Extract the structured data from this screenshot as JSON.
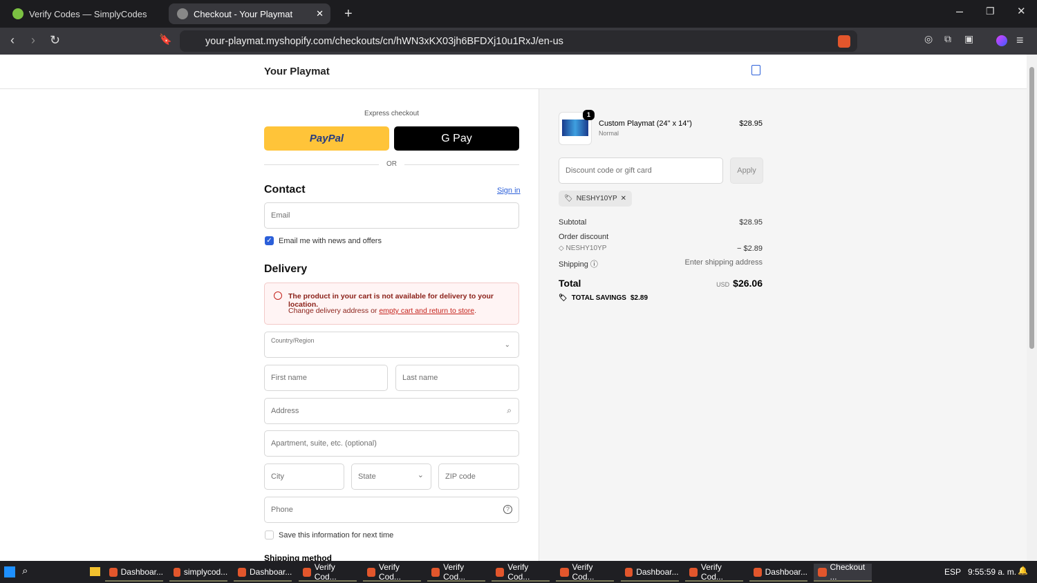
{
  "browser": {
    "tabs": [
      {
        "title": "Verify Codes — SimplyCodes"
      },
      {
        "title": "Checkout - Your Playmat"
      }
    ],
    "url": "your-playmat.myshopify.com/checkouts/cn/hWN3xKX03jh6BFDXj10u1RxJ/en-us",
    "new_tab": "+"
  },
  "header": {
    "store_name": "Your Playmat"
  },
  "express": {
    "label": "Express checkout",
    "paypal": "PayPal",
    "gpay": "G Pay",
    "or": "OR"
  },
  "contact": {
    "title": "Contact",
    "sign_in": "Sign in",
    "email_placeholder": "Email",
    "newsletter": "Email me with news and offers",
    "newsletter_checked": true
  },
  "delivery": {
    "title": "Delivery",
    "error_title": "The product in your cart is not available for delivery to your location.",
    "error_text": "Change delivery address or ",
    "error_link": "empty cart and return to store",
    "error_end": ".",
    "country_label": "Country/Region",
    "first_name": "First name",
    "last_name": "Last name",
    "address": "Address",
    "apartment": "Apartment, suite, etc. (optional)",
    "city": "City",
    "state": "State",
    "zip": "ZIP code",
    "phone": "Phone",
    "save_info": "Save this information for next time",
    "shipping_method": "Shipping method"
  },
  "summary": {
    "item": {
      "name": "Custom Playmat (24\" x 14\")",
      "variant": "Normal",
      "price": "$28.95",
      "qty": "1"
    },
    "discount_placeholder": "Discount code or gift card",
    "apply": "Apply",
    "code": "NESHY10YP",
    "subtotal_label": "Subtotal",
    "subtotal": "$28.95",
    "order_discount_label": "Order discount",
    "discount_amount": "− $2.89",
    "shipping_label": "Shipping",
    "shipping_value": "Enter shipping address",
    "total_label": "Total",
    "currency": "USD",
    "total": "$26.06",
    "savings_label": "TOTAL SAVINGS",
    "savings": "$2.89"
  },
  "taskbar": {
    "apps": [
      "Dashboar...",
      "simplycod...",
      "Dashboar...",
      "Verify Cod...",
      "Verify Cod...",
      "Verify Cod...",
      "Verify Cod...",
      "Verify Cod...",
      "Dashboar...",
      "Verify Cod...",
      "Dashboar...",
      "Checkout ..."
    ],
    "lang": "ESP",
    "time": "9:55:59 a. m."
  },
  "colors": {
    "accent": "#2b5fd9",
    "error": "#c4211a",
    "paypal": "#ffc439"
  }
}
